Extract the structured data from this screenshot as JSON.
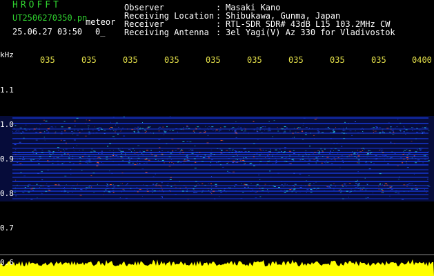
{
  "header": {
    "brand": "HROFFT",
    "file_name": "UT2506270350.pn",
    "meteor_label": "meteor",
    "datetime": "25.06.27 03:50",
    "count": "0_"
  },
  "info": [
    {
      "label": "Observer",
      "value": "Masaki Kano"
    },
    {
      "label": "Receiving Location",
      "value": "Shibukawa, Gunma, Japan"
    },
    {
      "label": "Receiver",
      "value": "RTL-SDR SDR# 43dB L15 103.2MHz CW"
    },
    {
      "label": "Receiving Antenna",
      "value": "3el Yagi(V) Az 330 for Vladivostok"
    }
  ],
  "axis": {
    "unit": "kHz",
    "y_ticks": [
      "1.1",
      "1.0",
      "0.9",
      "0.8",
      "0.7",
      "0.6"
    ],
    "time_ticks": [
      "035",
      "035",
      "035",
      "035",
      "035",
      "035",
      "035",
      "035",
      "035",
      "0400"
    ]
  },
  "colors": {
    "text_green": "#2fd12f",
    "text_yellow": "#e6e24a",
    "text_white": "#ffffff",
    "background": "#000000",
    "signal_blue": "#1a3ce0",
    "signal_cyan": "#27c7d8",
    "signal_hot": "#ff5a2a",
    "noise_bar": "#ffff00"
  }
}
